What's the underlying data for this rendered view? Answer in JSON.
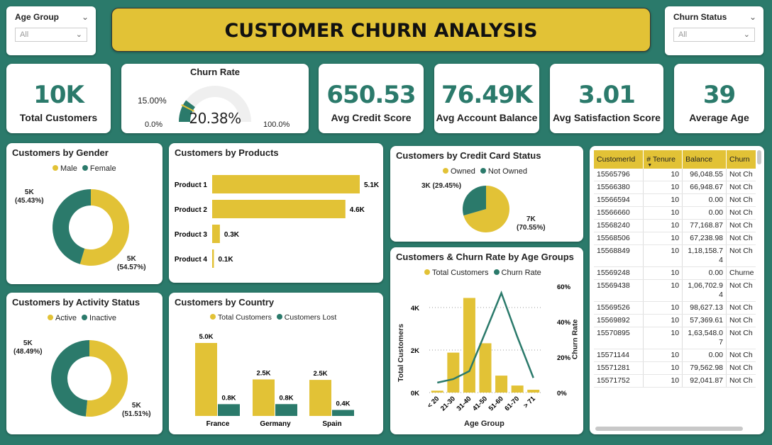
{
  "title": "CUSTOMER CHURN ANALYSIS",
  "slicers": {
    "age": {
      "label": "Age Group",
      "value": "All"
    },
    "churn": {
      "label": "Churn Status",
      "value": "All"
    }
  },
  "kpis": [
    {
      "value": "10K",
      "label": "Total Customers"
    },
    {
      "value": "650.53",
      "label": "Avg Credit Score"
    },
    {
      "value": "76.49K",
      "label": "Avg Account Balance"
    },
    {
      "value": "3.01",
      "label": "Avg Satisfaction Score"
    },
    {
      "value": "39",
      "label": "Average Age"
    }
  ],
  "gauge": {
    "title": "Churn Rate",
    "value": "20.38%",
    "target": "15.00%",
    "min": "0.0%",
    "max": "100.0%",
    "fraction": 0.2038,
    "target_fraction": 0.15
  },
  "colors": {
    "yellow": "#e2c236",
    "teal": "#2b7a6b",
    "bg": "#2b7a6b"
  },
  "charts": {
    "gender": {
      "title": "Customers by Gender",
      "legend": [
        "Male",
        "Female"
      ],
      "label_a": "5K",
      "label_a2": "(45.43%)",
      "label_b": "5K",
      "label_b2": "(54.57%)"
    },
    "activity": {
      "title": "Customers by Activity Status",
      "legend": [
        "Active",
        "Inactive"
      ],
      "label_a": "5K",
      "label_a2": "(48.49%)",
      "label_b": "5K",
      "label_b2": "(51.51%)"
    },
    "products": {
      "title": "Customers by Products"
    },
    "country": {
      "title": "Customers by Country",
      "legend": [
        "Total Customers",
        "Customers Lost"
      ]
    },
    "card": {
      "title": "Customers by Credit Card Status",
      "legend": [
        "Owned",
        "Not Owned"
      ],
      "label_a": "3K (29.45%)",
      "label_b": "7K",
      "label_b2": "(70.55%)"
    },
    "age": {
      "title": "Customers & Churn Rate by Age Groups",
      "legend": [
        "Total Customers",
        "Churn Rate"
      ],
      "ylabel": "Total Customers",
      "y2label": "Churn Rate",
      "xlabel": "Age Group"
    }
  },
  "chart_data": [
    {
      "type": "pie",
      "title": "Customers by Gender",
      "categories": [
        "Male",
        "Female"
      ],
      "values": [
        54.57,
        45.43
      ],
      "labels": [
        "5K (54.57%)",
        "5K (45.43%)"
      ]
    },
    {
      "type": "pie",
      "title": "Customers by Activity Status",
      "categories": [
        "Active",
        "Inactive"
      ],
      "values": [
        51.51,
        48.49
      ],
      "labels": [
        "5K (51.51%)",
        "5K (48.49%)"
      ]
    },
    {
      "type": "bar",
      "title": "Customers by Products",
      "categories": [
        "Product 1",
        "Product 2",
        "Product 3",
        "Product 4"
      ],
      "values": [
        5084,
        4590,
        266,
        60
      ],
      "data_labels": [
        "5.1K",
        "4.6K",
        "0.3K",
        "0.1K"
      ]
    },
    {
      "type": "bar",
      "title": "Customers by Country",
      "categories": [
        "France",
        "Germany",
        "Spain"
      ],
      "series": [
        {
          "name": "Total Customers",
          "values": [
            5014,
            2509,
            2477
          ],
          "data_labels": [
            "5.0K",
            "2.5K",
            "2.5K"
          ]
        },
        {
          "name": "Customers Lost",
          "values": [
            810,
            814,
            413
          ],
          "data_labels": [
            "0.8K",
            "0.8K",
            "0.4K"
          ]
        }
      ]
    },
    {
      "type": "pie",
      "title": "Customers by Credit Card Status",
      "categories": [
        "Owned",
        "Not Owned"
      ],
      "values": [
        70.55,
        29.45
      ],
      "labels": [
        "7K (70.55%)",
        "3K (29.45%)"
      ]
    },
    {
      "type": "bar",
      "title": "Customers & Churn Rate by Age Groups",
      "categories": [
        "< 20",
        "21-30",
        "31-40",
        "41-50",
        "51-60",
        "61-70",
        "> 71"
      ],
      "series": [
        {
          "name": "Total Customers",
          "values": [
            89,
            1879,
            4451,
            2320,
            797,
            331,
            133
          ]
        },
        {
          "name": "Churn Rate",
          "values": [
            5.6,
            7.6,
            12.1,
            34.0,
            56.2,
            31.4,
            8.3
          ]
        }
      ],
      "ylim": [
        0,
        4500
      ],
      "y2lim": [
        0,
        60
      ],
      "yticks": [
        "0K",
        "2K",
        "4K"
      ],
      "y2ticks": [
        "0%",
        "20%",
        "40%",
        "60%"
      ],
      "xlabel": "Age Group",
      "ylabel": "Total Customers",
      "y2label": "Churn Rate"
    }
  ],
  "table": {
    "columns": [
      "CustomerId",
      "# Tenure",
      "Balance",
      "Churn"
    ],
    "rows": [
      [
        "15565796",
        "10",
        "96,048.55",
        "Not Ch"
      ],
      [
        "15566380",
        "10",
        "66,948.67",
        "Not Ch"
      ],
      [
        "15566594",
        "10",
        "0.00",
        "Not Ch"
      ],
      [
        "15566660",
        "10",
        "0.00",
        "Not Ch"
      ],
      [
        "15568240",
        "10",
        "77,168.87",
        "Not Ch"
      ],
      [
        "15568506",
        "10",
        "67,238.98",
        "Not Ch"
      ],
      [
        "15568849",
        "10",
        "1,18,158.7\n4",
        "Not Ch"
      ],
      [
        "15569248",
        "10",
        "0.00",
        "Churne"
      ],
      [
        "15569438",
        "10",
        "1,06,702.9\n4",
        "Not Ch"
      ],
      [
        "15569526",
        "10",
        "98,627.13",
        "Not Ch"
      ],
      [
        "15569892",
        "10",
        "57,369.61",
        "Not Ch"
      ],
      [
        "15570895",
        "10",
        "1,63,548.0\n7",
        "Not Ch"
      ],
      [
        "15571144",
        "10",
        "0.00",
        "Not Ch"
      ],
      [
        "15571281",
        "10",
        "79,562.98",
        "Not Ch"
      ],
      [
        "15571752",
        "10",
        "92,041.87",
        "Not Ch"
      ]
    ]
  }
}
